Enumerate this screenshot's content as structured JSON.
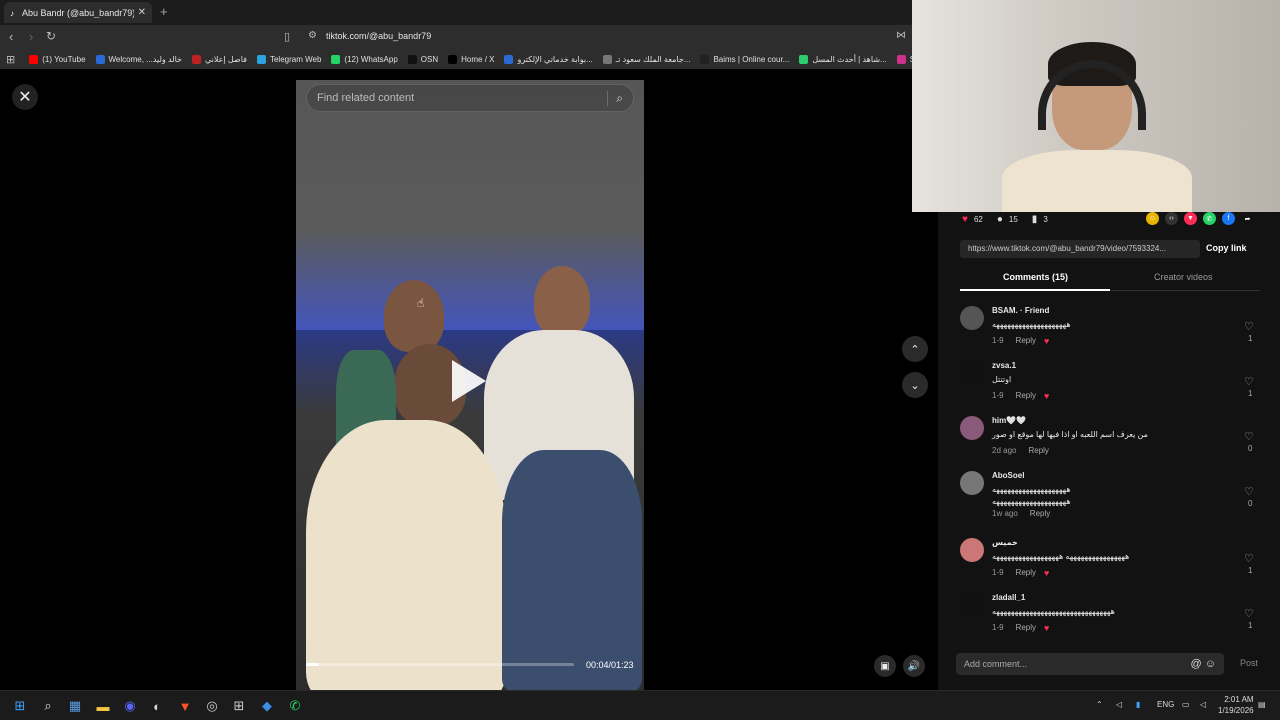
{
  "browser": {
    "tab_title": "Abu Bandr (@abu_bandr79) |",
    "url": "tiktok.com/@abu_bandr79",
    "bookmarks": [
      {
        "label": "(1) YouTube",
        "color": "#ff0000"
      },
      {
        "label": "Welcome, ...خالد وليد",
        "color": "#2a6ad4"
      },
      {
        "label": "فاصل إعلاني",
        "color": "#b22"
      },
      {
        "label": "Telegram Web",
        "color": "#2aa3e0"
      },
      {
        "label": "(12) WhatsApp",
        "color": "#25d366"
      },
      {
        "label": "OSN",
        "color": "#111"
      },
      {
        "label": "Home / X",
        "color": "#000"
      },
      {
        "label": "بوابة خدماتي الإلكترو...",
        "color": "#2a6ad4"
      },
      {
        "label": "جامعة الملك سعود تـ...",
        "color": "#777"
      },
      {
        "label": "Baims | Online cour...",
        "color": "#222"
      },
      {
        "label": "شاهد | أحدث المسل...",
        "color": "#2ecc71"
      },
      {
        "label": "Seec",
        "color": "#c38"
      }
    ]
  },
  "video": {
    "search_placeholder": "Find related content",
    "timecode": "00:04/01:23",
    "progress_fraction": 0.05
  },
  "side": {
    "likes": "62",
    "comments_count": "15",
    "saves": "3",
    "share_link": "https://www.tiktok.com/@abu_bandr79/video/7593324...",
    "copy_link_label": "Copy link",
    "tab_comments": "Comments (15)",
    "tab_creator": "Creator videos",
    "add_comment_placeholder": "Add comment...",
    "post_label": "Post",
    "reply_label": "Reply"
  },
  "comments": [
    {
      "user": "BSAM. · Friend",
      "line1": "ههههههههههههههههههههه",
      "line2": "",
      "meta": "1-9",
      "likes": "1",
      "avatar": "#555",
      "crit": true
    },
    {
      "user": "zvsa.1",
      "line1": "اوتتتل",
      "line2": "",
      "meta": "1-9",
      "likes": "1",
      "avatar": "#111",
      "crit": true
    },
    {
      "user": "him🤍🤍",
      "line1": "من يعرف اسم اللعبه او اذا فيها لها موقع او صور",
      "line2": "",
      "meta": "2d ago",
      "likes": "0",
      "avatar": "#8a5a7a",
      "crit": false
    },
    {
      "user": "AboSoel",
      "line1": "ههههههههههههههههههههه",
      "line2": "ههههههههههههههههههههه",
      "meta": "1w ago",
      "likes": "0",
      "avatar": "#777",
      "crit": false
    },
    {
      "user": "خميس",
      "line1": "ههههههههههههههههه ههههههههههههههههههه",
      "line2": "",
      "meta": "1-9",
      "likes": "1",
      "avatar": "#c77",
      "crit": true
    },
    {
      "user": "zladall_1",
      "line1": "ههههههههههههههههههههههههههههههههه",
      "line2": "",
      "meta": "1-9",
      "likes": "1",
      "avatar": "#111",
      "crit": true
    }
  ],
  "taskbar": {
    "lang": "ENG",
    "time": "2:01 AM",
    "date": "1/19/2026"
  }
}
